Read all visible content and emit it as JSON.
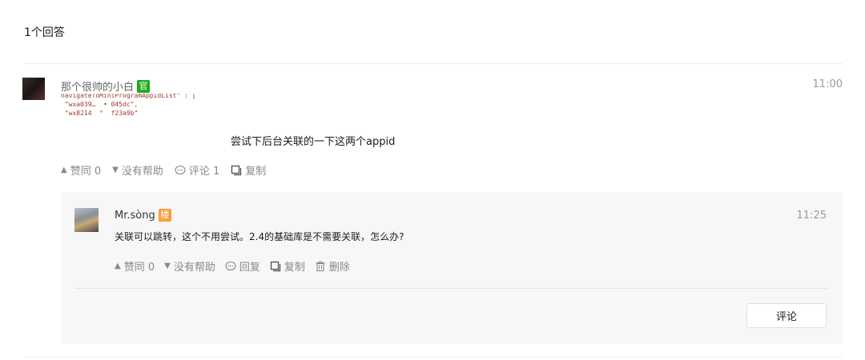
{
  "header": {
    "answer_count_label": "1个回答"
  },
  "answer": {
    "author_name": "那个很帅的小白",
    "badge": "官",
    "time": "11:00",
    "code_lines": [
      "navigateToMiniProgramAppIdList\" : [",
      " \"wxa039…  • 045dc\",",
      " \"wx8214  °  f23a9b\""
    ],
    "text": "尝试下后台关联的一下这两个appid",
    "actions": {
      "upvote": "赞同 0",
      "downvote": "没有帮助",
      "comment": "评论 1",
      "copy": "复制"
    }
  },
  "reply": {
    "author_name": "Mr.sòng",
    "badge": "楼",
    "time": "11:25",
    "text": "关联可以跳转，这个不用尝试。2.4的基础库是不需要关联，怎么办?",
    "actions": {
      "upvote": "赞同 0",
      "downvote": "没有帮助",
      "reply": "回复",
      "copy": "复制",
      "delete": "删除"
    }
  },
  "comment_button_label": "评论",
  "colors": {
    "official_badge": "#1aad19",
    "floor_badge": "#fa9d3b",
    "reply_background": "#f7f7f7"
  }
}
